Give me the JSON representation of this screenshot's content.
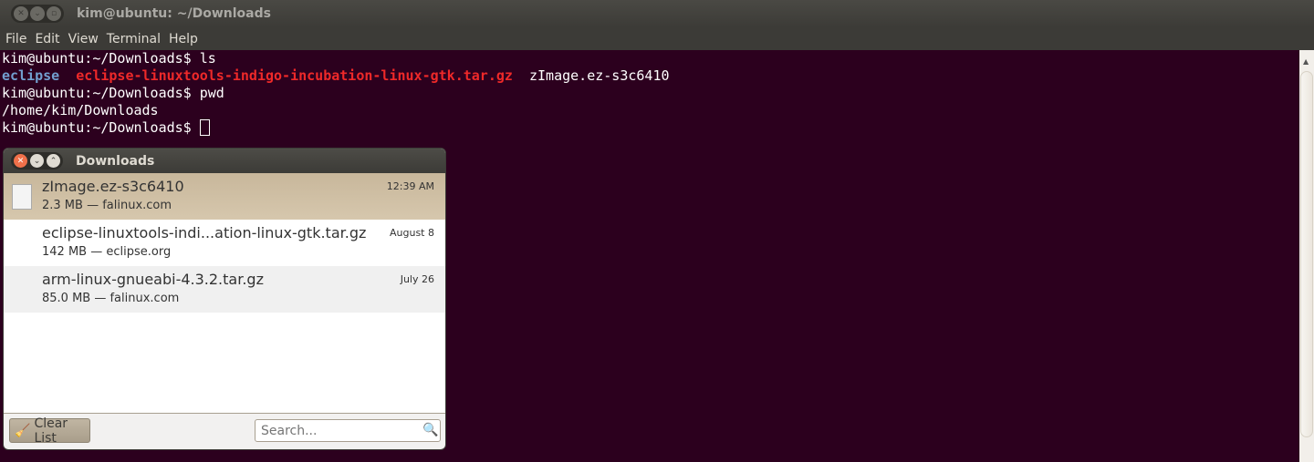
{
  "window": {
    "title": "kim@ubuntu: ~/Downloads"
  },
  "menu": [
    "File",
    "Edit",
    "View",
    "Terminal",
    "Help"
  ],
  "terminal": {
    "prompt": "kim@ubuntu:~/Downloads$ ",
    "cmd1": "ls",
    "ls": [
      "eclipse",
      "eclipse-linuxtools-indigo-incubation-linux-gtk.tar.gz",
      "zImage.ez-s3c6410"
    ],
    "cmd2": "pwd",
    "pwd_out": "/home/kim/Downloads"
  },
  "downloads": {
    "title": "Downloads",
    "items": [
      {
        "name": "zImage.ez-s3c6410",
        "meta": "2.3 MB — falinux.com",
        "time": "12:39 AM"
      },
      {
        "name": "eclipse-linuxtools-indi...ation-linux-gtk.tar.gz",
        "meta": "142 MB — eclipse.org",
        "time": "August 8"
      },
      {
        "name": "arm-linux-gnueabi-4.3.2.tar.gz",
        "meta": "85.0 MB — falinux.com",
        "time": "July 26"
      }
    ],
    "clear_label": "Clear List",
    "search_placeholder": "Search..."
  }
}
